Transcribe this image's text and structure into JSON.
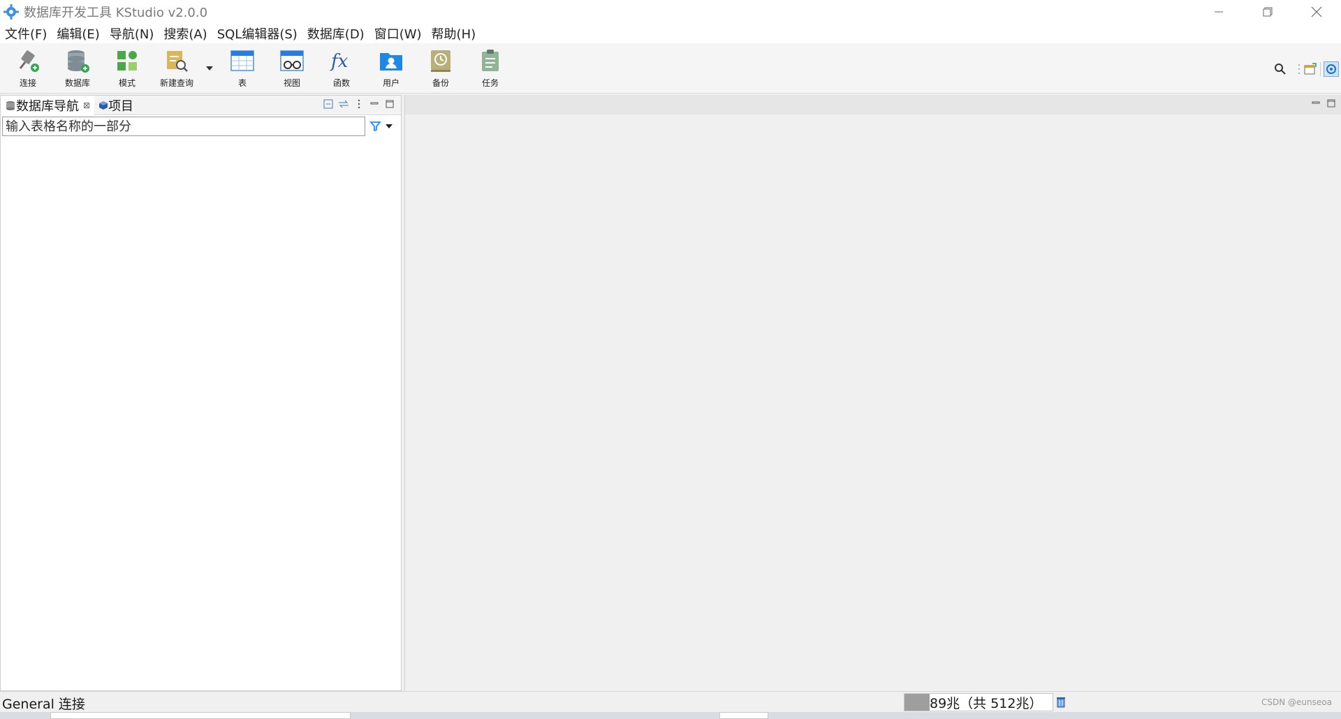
{
  "window": {
    "title": "数据库开发工具 KStudio v2.0.0"
  },
  "menu": [
    {
      "label": "文件(F)"
    },
    {
      "label": "编辑(E)"
    },
    {
      "label": "导航(N)"
    },
    {
      "label": "搜索(A)"
    },
    {
      "label": "SQL编辑器(S)"
    },
    {
      "label": "数据库(D)"
    },
    {
      "label": "窗口(W)"
    },
    {
      "label": "帮助(H)"
    }
  ],
  "toolbar": {
    "items": [
      {
        "label": "连接",
        "icon": "plug-connect-icon"
      },
      {
        "label": "数据库",
        "icon": "database-add-icon"
      },
      {
        "label": "模式",
        "icon": "schema-grid-icon"
      },
      {
        "label": "新建查询",
        "icon": "new-query-icon"
      },
      {
        "label": "表",
        "icon": "table-icon"
      },
      {
        "label": "视图",
        "icon": "view-icon"
      },
      {
        "label": "函数",
        "icon": "function-icon"
      },
      {
        "label": "用户",
        "icon": "user-folder-icon"
      },
      {
        "label": "备份",
        "icon": "backup-clock-icon"
      },
      {
        "label": "任务",
        "icon": "task-clipboard-icon"
      }
    ]
  },
  "navigator": {
    "tabs": [
      {
        "label": "数据库导航",
        "active": true
      },
      {
        "label": "项目",
        "active": false
      }
    ],
    "filter": {
      "placeholder": "输入表格名称的一部分",
      "value": ""
    }
  },
  "status": {
    "left_text": "General 连接",
    "heap_text": "89兆（共 512兆）",
    "heap_used_fraction": 0.17,
    "watermark": "CSDN @eunseoa"
  },
  "colors": {
    "accent": "#1e90ff",
    "toolbar_bg": "#f5f5f5",
    "panel_bg": "#ffffff",
    "editor_bg": "#f0f0f0"
  }
}
